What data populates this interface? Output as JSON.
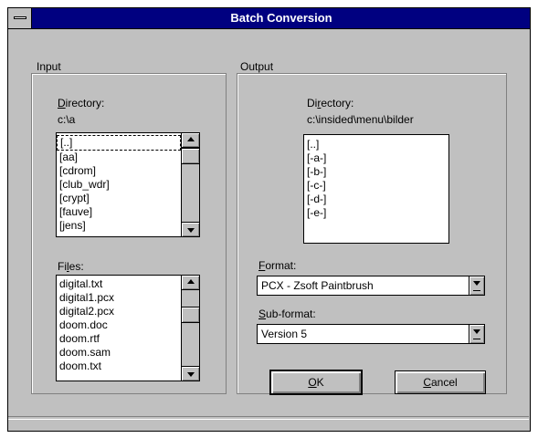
{
  "window": {
    "title": "Batch Conversion"
  },
  "input": {
    "group_label": "Input",
    "directory_label_prefix": "D",
    "directory_label_rest": "irectory:",
    "directory_path": "c:\\a",
    "directories": [
      "[..]",
      "[aa]",
      "[cdrom]",
      "[club_wdr]",
      "[crypt]",
      "[fauve]",
      "[jens]"
    ],
    "files_label_prefix": "Fi",
    "files_label_u": "l",
    "files_label_rest": "es:",
    "files": [
      "digital.txt",
      "digital1.pcx",
      "digital2.pcx",
      "doom.doc",
      "doom.rtf",
      "doom.sam",
      "doom.txt"
    ]
  },
  "output": {
    "group_label": "Output",
    "directory_label_prefix": "Di",
    "directory_label_u": "r",
    "directory_label_rest": "ectory:",
    "directory_path": "c:\\insided\\menu\\bilder",
    "directories": [
      "[..]",
      "[-a-]",
      "[-b-]",
      "[-c-]",
      "[-d-]",
      "[-e-]"
    ],
    "format_label_u": "F",
    "format_label_rest": "ormat:",
    "format_value": "PCX - Zsoft Paintbrush",
    "subformat_label_u": "S",
    "subformat_label_rest": "ub-format:",
    "subformat_value": "Version 5"
  },
  "buttons": {
    "ok_u": "O",
    "ok_rest": "K",
    "cancel_u": "C",
    "cancel_rest": "ancel"
  }
}
